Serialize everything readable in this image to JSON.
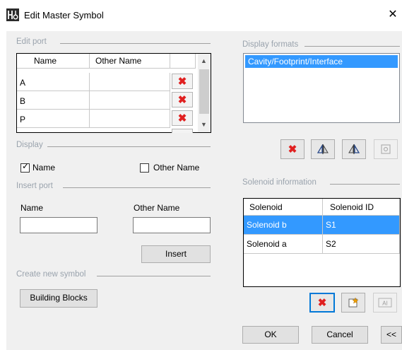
{
  "window": {
    "title": "Edit Master Symbol",
    "close_glyph": "✕"
  },
  "edit_port": {
    "label": "Edit port",
    "columns": [
      "Name",
      "Other Name"
    ],
    "rows": [
      {
        "name": "A",
        "other": ""
      },
      {
        "name": "B",
        "other": ""
      },
      {
        "name": "P",
        "other": ""
      }
    ],
    "delete_glyph": "✖"
  },
  "display": {
    "label": "Display",
    "name_checkbox": {
      "label": "Name",
      "checked": true
    },
    "other_checkbox": {
      "label": "Other Name",
      "checked": false
    }
  },
  "insert_port": {
    "label": "Insert port",
    "name_label": "Name",
    "other_label": "Other Name",
    "name_value": "",
    "other_value": "",
    "insert_button": "Insert"
  },
  "create_symbol": {
    "label": "Create new symbol",
    "button": "Building Blocks"
  },
  "display_formats": {
    "label": "Display formats",
    "items": [
      "Cavity/Footprint/Interface"
    ],
    "selected_index": 0,
    "toolbar_icons": [
      "delete-icon",
      "mirror-left-icon",
      "mirror-right-icon",
      "properties-icon"
    ]
  },
  "solenoid": {
    "label": "Solenoid information",
    "columns": [
      "Solenoid",
      "Solenoid ID"
    ],
    "rows": [
      {
        "solenoid": "Solenoid b",
        "id": "S1",
        "selected": true
      },
      {
        "solenoid": "Solenoid a",
        "id": "S2",
        "selected": false
      }
    ],
    "toolbar_icons": [
      "delete-icon",
      "add-icon",
      "text-field-icon"
    ],
    "ai_label": "AI"
  },
  "footer": {
    "ok": "OK",
    "cancel": "Cancel",
    "collapse": "<<"
  },
  "colors": {
    "selection": "#3399ff",
    "delete_red": "#e02020",
    "group_label": "#9aa3ad"
  }
}
